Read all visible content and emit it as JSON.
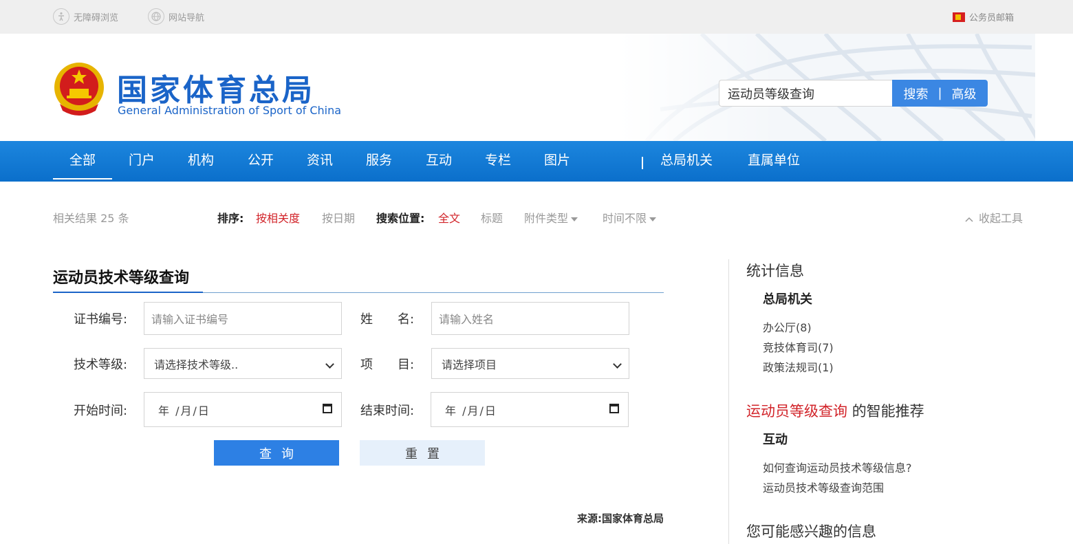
{
  "topbar": {
    "accessible_label": "无障碍浏览",
    "sitemap_label": "网站导航",
    "mail_label": "公务员邮箱"
  },
  "header": {
    "logo_cn": "国家体育总局",
    "logo_en": "General Administration of Sport of China",
    "search_value": "运动员等级查询",
    "search_label": "搜索",
    "search_sep": "|",
    "advanced_label": "高级"
  },
  "nav": {
    "items": [
      "全部",
      "门户",
      "机构",
      "公开",
      "资讯",
      "服务",
      "互动",
      "专栏",
      "图片"
    ],
    "sep": "|",
    "right_items": [
      "总局机关",
      "直属单位"
    ]
  },
  "filter": {
    "results_prefix": "相关结果",
    "results_count": "25",
    "results_suffix": "条",
    "sort_label": "排序:",
    "sort_relevance": "按相关度",
    "sort_date": "按日期",
    "position_label": "搜索位置:",
    "position_full": "全文",
    "position_title": "标题",
    "attachment": "附件类型",
    "time": "时间不限",
    "collapse": "收起工具"
  },
  "form": {
    "title": "运动员技术等级查询",
    "cert_label": "证书编号:",
    "cert_placeholder": "请输入证书编号",
    "name_label": "姓　　名:",
    "name_placeholder": "请输入姓名",
    "level_label": "技术等级:",
    "level_placeholder": "请选择技术等级..",
    "event_label": "项　　目:",
    "event_placeholder": "请选择项目",
    "start_label": "开始时间:",
    "end_label": "结束时间:",
    "date_placeholder": "年 /月/日",
    "query_button": "查询",
    "reset_button": "重置",
    "source": "来源:国家体育总局"
  },
  "sidebar": {
    "stats_title": "统计信息",
    "stats_group": "总局机关",
    "stats_items": [
      "办公厅(8)",
      "竞技体育司(7)",
      "政策法规司(1)"
    ],
    "rec_keyword": "运动员等级查询",
    "rec_suffix": "的智能推荐",
    "rec_group": "互动",
    "rec_items": [
      "如何查询运动员技术等级信息?",
      "运动员技术等级查询范围"
    ],
    "interest_title": "您可能感兴趣的信息"
  },
  "colors": {
    "brand_blue": "#1a64c8",
    "nav_blue": "#0b6fcb",
    "accent_red": "#d2242a",
    "button_blue": "#2d80e4"
  }
}
